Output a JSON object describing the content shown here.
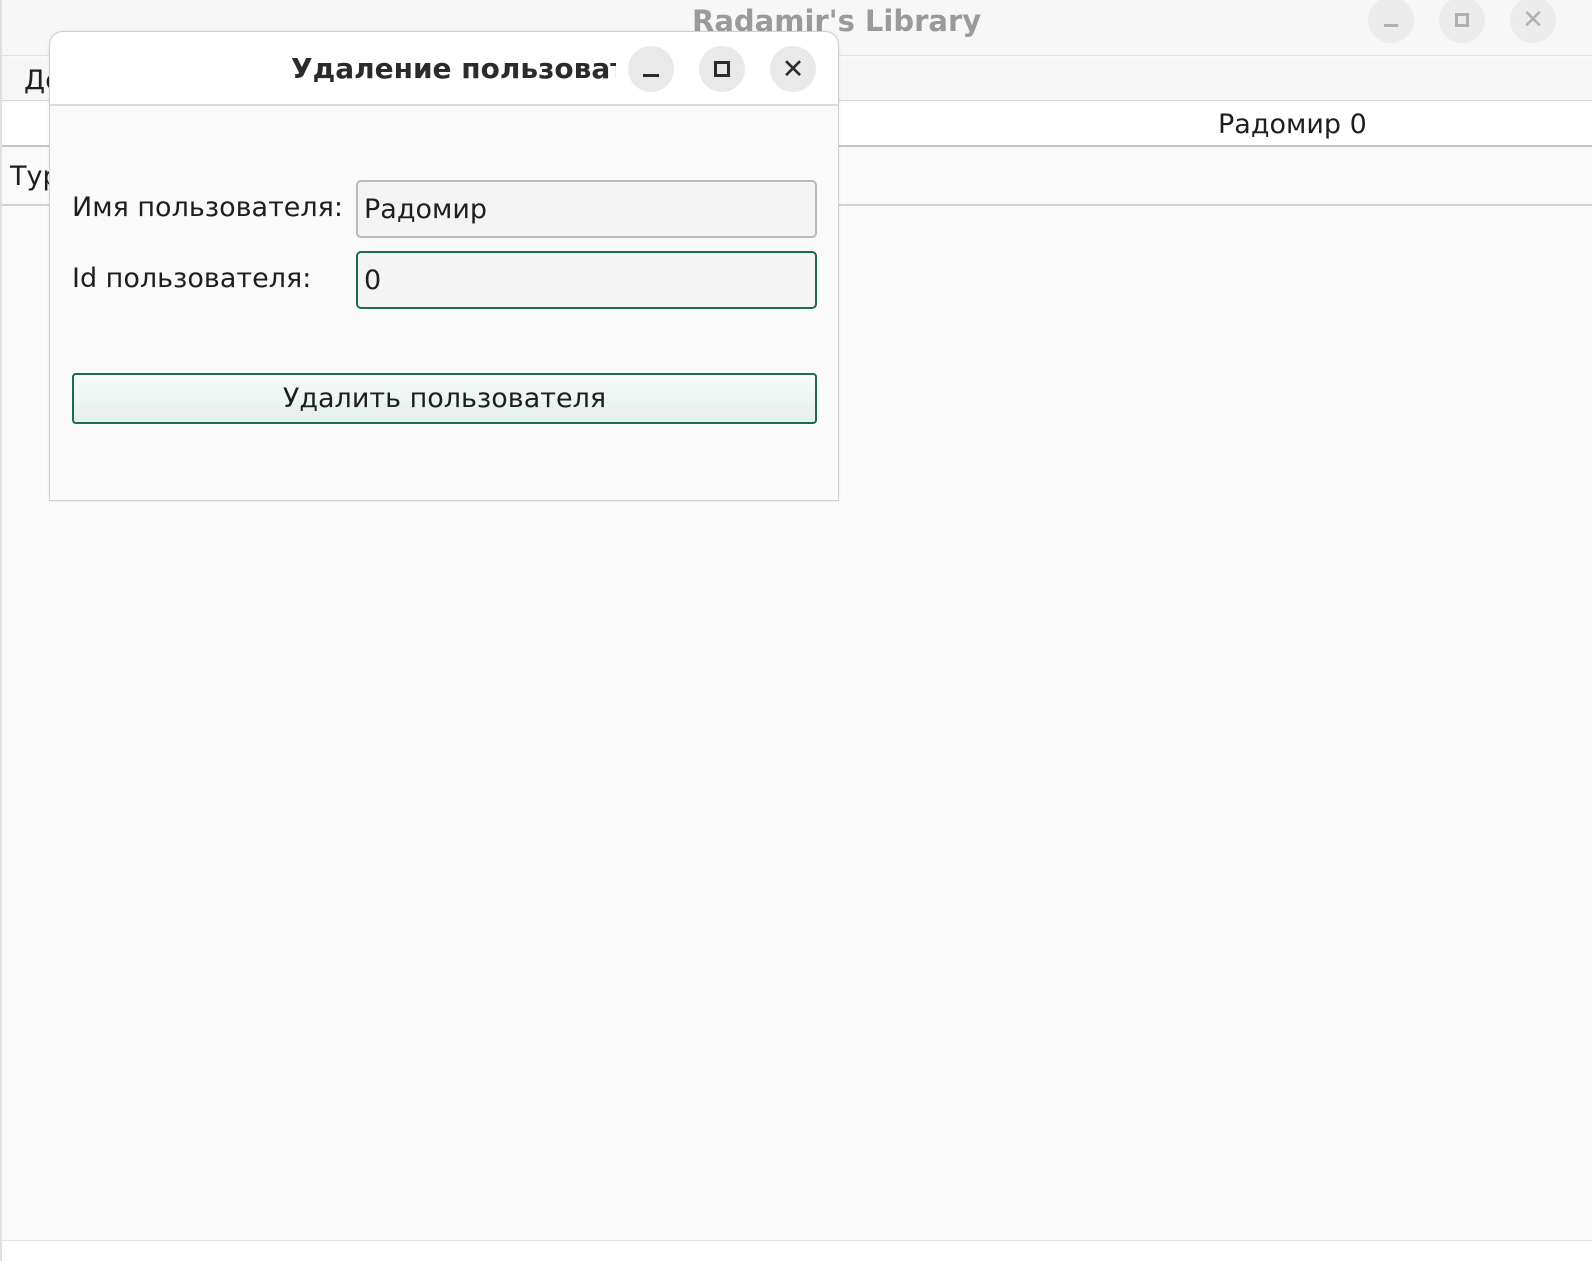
{
  "main_window": {
    "title": "Radamir's Library",
    "menu_items": [
      "Дс"
    ],
    "user_header": "Радомир 0",
    "type_row_label": "Тур"
  },
  "dialog": {
    "title": "Удаление пользовател",
    "username_label": "Имя пользователя:",
    "username_value": "Радомир",
    "userid_label": "Id пользователя:",
    "userid_value": "0",
    "delete_button_label": "Удалить пользователя"
  },
  "icons": {
    "minimize": "minimize-icon",
    "maximize": "maximize-icon",
    "close": "close-icon"
  },
  "colors": {
    "accent": "#1d6b4f",
    "title_inactive": "#9a9a9a"
  }
}
